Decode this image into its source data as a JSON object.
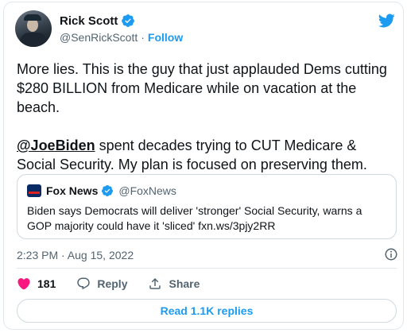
{
  "author": {
    "name": "Rick Scott",
    "handle": "@SenRickScott",
    "separator": "·",
    "follow_label": "Follow",
    "verified": true
  },
  "tweet": {
    "paragraph1": "More lies. This is the guy that just applauded Dems cutting $280 BILLION from Medicare while on vacation at the beach.",
    "mention": "@JoeBiden",
    "paragraph2_rest": " spent decades trying to CUT Medicare & Social Security. My plan is focused on preserving them."
  },
  "quoted": {
    "name": "Fox News",
    "handle": "@FoxNews",
    "verified": true,
    "text": "Biden says Democrats will deliver 'stronger' Social Security, warns a GOP majority could have it 'sliced' fxn.ws/3pjy2RR"
  },
  "meta": {
    "timestamp": "2:23 PM · Aug 15, 2022"
  },
  "actions": {
    "like_count": "181",
    "reply_label": "Reply",
    "share_label": "Share"
  },
  "replies_button": "Read 1.1K replies",
  "colors": {
    "accent": "#1d9bf0",
    "like": "#f91880",
    "text": "#0f1419",
    "muted": "#536471"
  },
  "icons": [
    "twitter-bird-icon",
    "verified-badge-icon",
    "info-icon",
    "heart-icon",
    "reply-bubble-icon",
    "share-icon"
  ]
}
